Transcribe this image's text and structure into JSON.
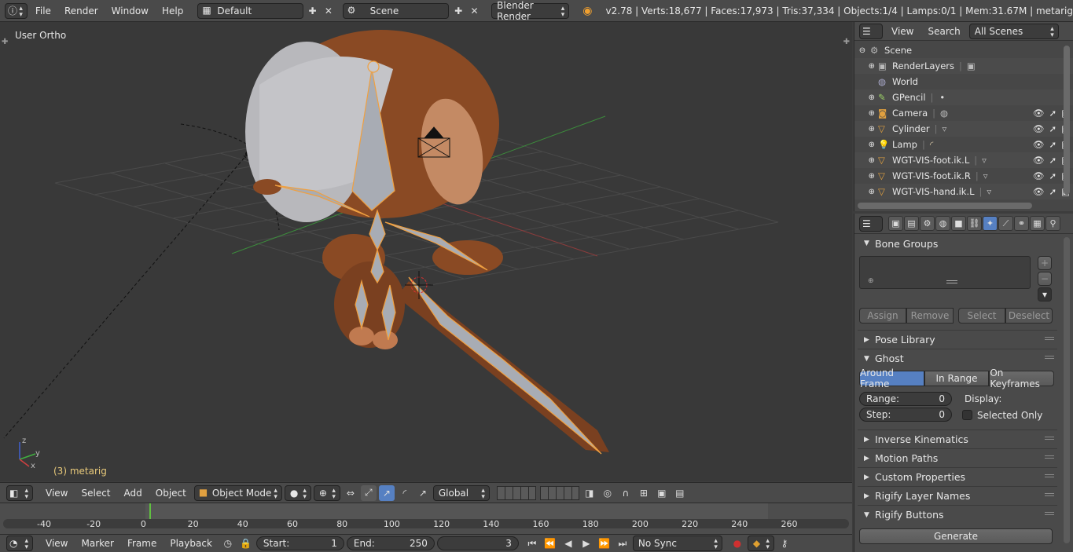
{
  "topbar": {
    "menus": [
      "File",
      "Render",
      "Window",
      "Help"
    ],
    "layout": "Default",
    "scene": "Scene",
    "engine": "Blender Render",
    "stats": "v2.78 | Verts:18,677 | Faces:17,973 | Tris:37,334 | Objects:1/4 | Lamps:0/1 | Mem:31.67M | metarig"
  },
  "viewport": {
    "label": "User Ortho",
    "object": "(3) metarig"
  },
  "vp_header": {
    "menus": [
      "View",
      "Select",
      "Add",
      "Object"
    ],
    "mode": "Object Mode",
    "orientation": "Global"
  },
  "timeline": {
    "ticks": [
      "-40",
      "-20",
      "0",
      "20",
      "40",
      "60",
      "80",
      "100",
      "120",
      "140",
      "160",
      "180",
      "200",
      "220",
      "240",
      "260"
    ],
    "menus": [
      "View",
      "Marker",
      "Frame",
      "Playback"
    ],
    "start_label": "Start:",
    "start": "1",
    "end_label": "End:",
    "end": "250",
    "current": "3",
    "sync": "No Sync"
  },
  "outliner": {
    "menus": [
      "View",
      "Search"
    ],
    "filter": "All Scenes",
    "items": [
      "Scene",
      "RenderLayers",
      "World",
      "GPencil",
      "Camera",
      "Cylinder",
      "Lamp",
      "WGT-VIS-foot.ik.L",
      "WGT-VIS-foot.ik.R",
      "WGT-VIS-hand.ik.L"
    ]
  },
  "props": {
    "bone_groups": "Bone Groups",
    "bg_buttons": [
      "Assign",
      "Remove",
      "Select",
      "Deselect"
    ],
    "pose_library": "Pose Library",
    "ghost": "Ghost",
    "ghost_modes": [
      "Around Frame",
      "In Range",
      "On Keyframes"
    ],
    "range_label": "Range:",
    "range": "0",
    "step_label": "Step:",
    "step": "0",
    "display_label": "Display:",
    "selected_only": "Selected Only",
    "panels": [
      "Inverse Kinematics",
      "Motion Paths",
      "Custom Properties",
      "Rigify Layer Names"
    ],
    "rigify_buttons": "Rigify Buttons",
    "generate": "Generate"
  }
}
